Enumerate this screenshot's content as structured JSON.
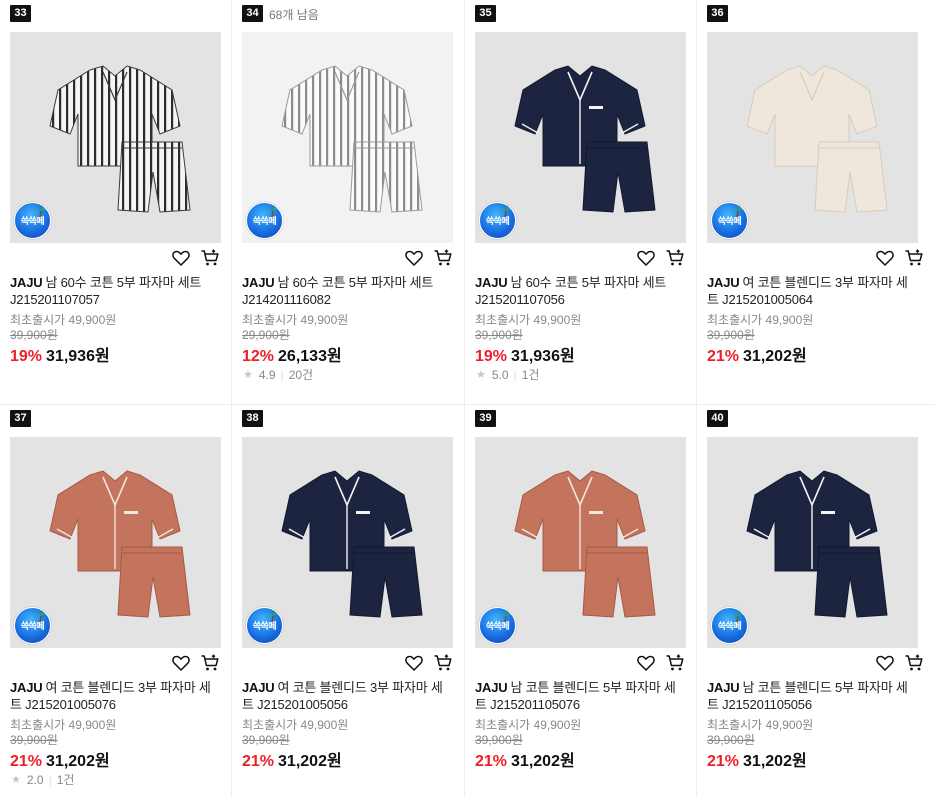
{
  "labels": {
    "badge_text": "쓱쓱페"
  },
  "colors": {
    "discount": "#f01e28",
    "badge_blue": "#1a6fe0"
  },
  "icons": {
    "wish": "heart-icon",
    "cart": "cart-icon",
    "rating": "star-icon"
  },
  "products": [
    {
      "rank": "33",
      "brand": "JAJU",
      "name": "남 60수 코튼 5부 파자마 세트 J215201107057",
      "launch_price": "최초출시가 49,900원",
      "original_price": "39,900원",
      "discount": "19%",
      "price": "31,936원",
      "pattern": "stripe-dark"
    },
    {
      "rank": "34",
      "remaining": "68개 남음",
      "brand": "JAJU",
      "name": "남 60수 코튼 5부 파자마 세트 J214201116082",
      "launch_price": "최초출시가 49,900원",
      "original_price": "29,900원",
      "discount": "12%",
      "price": "26,133원",
      "rating": "4.9",
      "review_count": "20건",
      "pattern": "stripe-light"
    },
    {
      "rank": "35",
      "brand": "JAJU",
      "name": "남 60수 코튼 5부 파자마 세트 J215201107056",
      "launch_price": "최초출시가 49,900원",
      "original_price": "39,900원",
      "discount": "19%",
      "price": "31,936원",
      "rating": "5.0",
      "review_count": "1건",
      "pattern": "navy"
    },
    {
      "rank": "36",
      "brand": "JAJU",
      "name": "여 코튼 블렌디드 3부 파자마 세트 J215201005064",
      "launch_price": "최초출시가 49,900원",
      "original_price": "39,900원",
      "discount": "21%",
      "price": "31,202원",
      "pattern": "ivory"
    },
    {
      "rank": "37",
      "brand": "JAJU",
      "name": "여 코튼 블렌디드 3부 파자마 세트 J215201005076",
      "launch_price": "최초출시가 49,900원",
      "original_price": "39,900원",
      "discount": "21%",
      "price": "31,202원",
      "rating": "2.0",
      "review_count": "1건",
      "pattern": "terracotta"
    },
    {
      "rank": "38",
      "brand": "JAJU",
      "name": "여 코튼 블렌디드 3부 파자마 세트 J215201005056",
      "launch_price": "최초출시가 49,900원",
      "original_price": "39,900원",
      "discount": "21%",
      "price": "31,202원",
      "pattern": "navy"
    },
    {
      "rank": "39",
      "brand": "JAJU",
      "name": "남 코튼 블렌디드 5부 파자마 세트 J215201105076",
      "launch_price": "최초출시가 49,900원",
      "original_price": "39,900원",
      "discount": "21%",
      "price": "31,202원",
      "pattern": "terracotta"
    },
    {
      "rank": "40",
      "brand": "JAJU",
      "name": "남 코튼 블렌디드 5부 파자마 세트 J215201105056",
      "launch_price": "최초출시가 49,900원",
      "original_price": "39,900원",
      "discount": "21%",
      "price": "31,202원",
      "pattern": "navy"
    }
  ]
}
